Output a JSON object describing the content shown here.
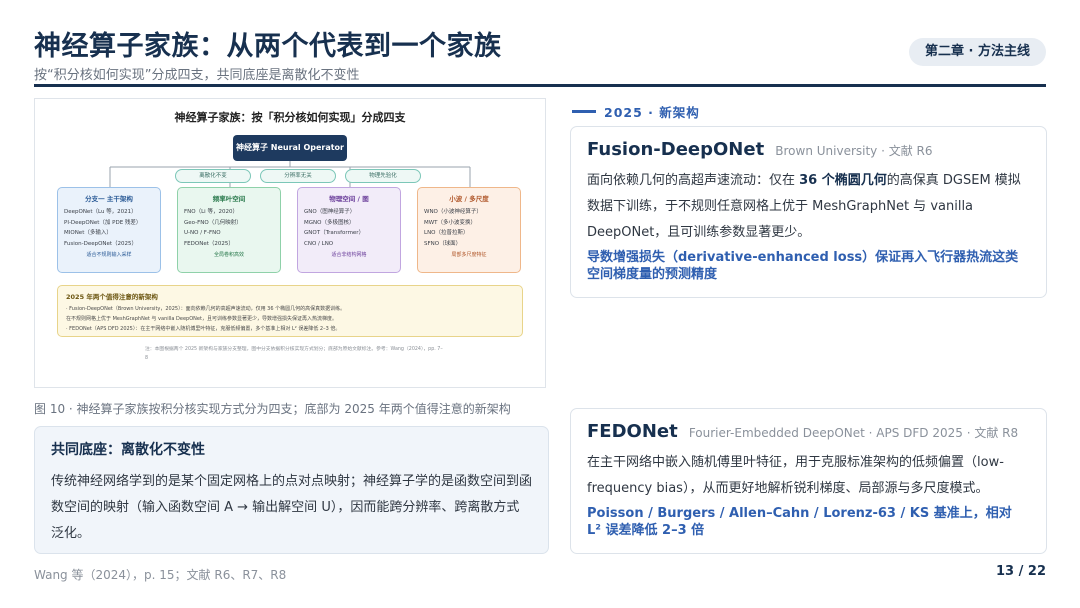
{
  "header": {
    "title": "神经算子家族：从两个代表到一个家族",
    "subtitle": "按“积分核如何实现”分成四支，共同底座是离散化不变性",
    "chapter": "第二章 · 方法主线"
  },
  "figure": {
    "title": "神经算子家族：按「积分核如何实现」分成四支",
    "root": "神经算子 Neural Operator",
    "chips": [
      "离散化不变",
      "分辨率无关",
      "物理先验化"
    ],
    "branches": [
      {
        "title": "分支一 主干架构",
        "items": [
          "DeepONet（Lu 等，2021）",
          "PI-DeepONet（加 PDE 残差）",
          "MIONet（多输入）",
          "Fusion-DeepONet（2025）"
        ],
        "footer": "适合不规则输入采样"
      },
      {
        "title": "频率叶空间",
        "items": [
          "FNO（Li 等，2020）",
          "Geo-FNO（几何映射）",
          "U-NO / F-FNO",
          "FEDONet（2025）"
        ],
        "footer": "全局卷积高效"
      },
      {
        "title": "物理空间 / 图",
        "items": [
          "GNO（图神经算子）",
          "MGNO（多极图核）",
          "GNOT（Transformer）",
          "CNO / LNO"
        ],
        "footer": "适合非结构网格"
      },
      {
        "title": "小波 / 多尺度",
        "items": [
          "WNO（小波神经算子）",
          "MWT（多小波变换）",
          "LNO（拉普拉斯）",
          "SFNO（球面）"
        ],
        "footer": "局部多尺度特征"
      }
    ],
    "notes_title": "2025 年两个值得注意的新架构",
    "notes": [
      "· Fusion-DeepONet（Brown University，2025）：面向依赖几何的高超声速流动，仅用 36 个椭圆几何的高保真数据训练。",
      "  在不规则网格上优于 MeshGraphNet 与 vanilla DeepONet，且可训练参数显著更少，导数增强损失保证再入热流梯度。",
      "· FEDONet（APS DFD 2025）：在主干网络中嵌入随机傅里叶特征，克服低频偏置，多个基准上相对 L² 误差降低 2–3 倍。"
    ],
    "footnote": "注：本图根据两个 2025 新架构与家族分支整理，图中分支依据积分核实现方式划分；底部为原始文献标注。参考：Wang（2024），pp. 7–8",
    "caption": "图 10 · 神经算子家族按积分核实现方式分为四支；底部为 2025 年两个值得注意的新架构"
  },
  "basis": {
    "title": "共同底座：离散化不变性",
    "body": "传统神经网络学到的是某个固定网格上的点对点映射；神经算子学的是函数空间到函数空间的映射（输入函数空间 A → 输出解空间 U），因而能跨分辨率、跨离散方式泛化。"
  },
  "new_section_label": "2025 · 新架构",
  "cards": [
    {
      "name": "Fusion-DeepONet",
      "source": "Brown University · 文献 R6",
      "body_pre": "面向依赖几何的高超声速流动：仅在 ",
      "body_bold": "36 个椭圆几何",
      "body_post": "的高保真 DGSEM 模拟数据下训练，于不规则任意网格上优于 MeshGraphNet 与 vanilla DeepONet，且可训练参数显著更少。",
      "highlight": "导数增强损失（derivative-enhanced loss）保证再入飞行器热流这类空间梯度量的预测精度"
    },
    {
      "name": "FEDONet",
      "source": "Fourier-Embedded DeepONet · APS DFD 2025 · 文献 R8",
      "body": "在主干网络中嵌入随机傅里叶特征，用于克服标准架构的低频偏置（low-frequency bias），从而更好地解析锐利梯度、局部源与多尺度模式。",
      "highlight": "Poisson / Burgers / Allen–Cahn / Lorenz-63 / KS 基准上，相对 L² 误差降低 2–3 倍"
    }
  ],
  "footer": {
    "left": "Wang 等（2024），p. 15；文献 R6、R7、R8",
    "right": "13 / 22"
  }
}
